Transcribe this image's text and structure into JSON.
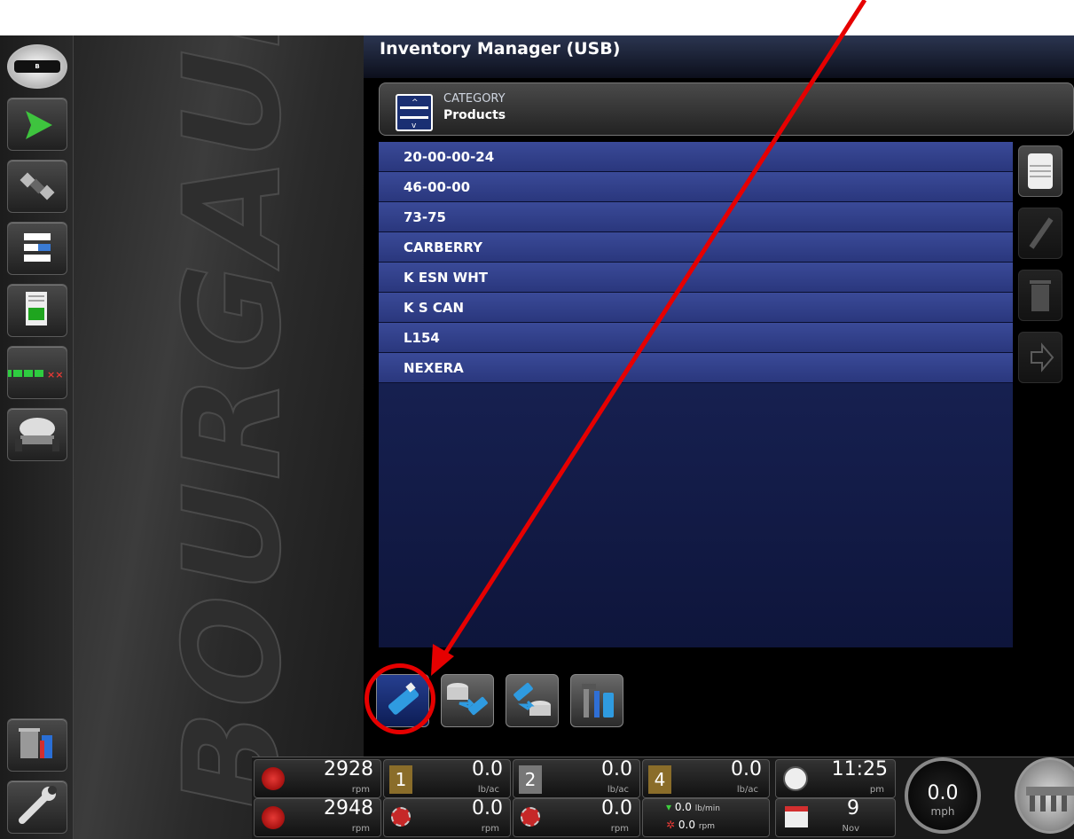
{
  "app": {
    "title": "Inventory Manager (USB)"
  },
  "sidebar": {
    "logo_icon": "bourgault-logo",
    "items": [
      {
        "name": "guidance-icon"
      },
      {
        "name": "gps-satellite-icon"
      },
      {
        "name": "product-layout-icon"
      },
      {
        "name": "report-icon"
      },
      {
        "name": "section-status-icon"
      },
      {
        "name": "implement-icon"
      }
    ],
    "bottom_items": [
      {
        "name": "trash-usb-icon"
      },
      {
        "name": "wrench-icon"
      }
    ]
  },
  "brand_watermark": "BOURGAULT",
  "category": {
    "label": "CATEGORY",
    "value": "Products"
  },
  "list": {
    "items": [
      "20-00-00-24",
      "46-00-00",
      "73-75",
      "CARBERRY",
      "K ESN WHT",
      "K S CAN",
      "L154",
      "NEXERA"
    ]
  },
  "right_toolbar": [
    "list-scroll-icon",
    "edit-pencil-icon",
    "delete-trash-icon",
    "export-arrow-icon"
  ],
  "bottom_toolbar": [
    "usb-drive-icon",
    "database-to-usb-icon",
    "usb-to-database-icon",
    "usb-tools-icon"
  ],
  "status_bar": {
    "rpm1": {
      "value": "2928",
      "unit": "rpm"
    },
    "rpm2": {
      "value": "2948",
      "unit": "rpm"
    },
    "tank1": {
      "num": "1",
      "rate": "0.0",
      "rate_unit": "lb/ac",
      "meter": "0.0",
      "meter_unit": "rpm"
    },
    "tank2": {
      "num": "2",
      "rate": "0.0",
      "rate_unit": "lb/ac",
      "meter": "0.0",
      "meter_unit": "rpm"
    },
    "tank4": {
      "num": "4",
      "rate": "0.0",
      "rate_unit": "lb/ac",
      "flow": "0.0",
      "flow_unit": "lb/min",
      "meter": "0.0",
      "meter_unit": "rpm"
    },
    "time": {
      "value": "11:25",
      "ampm": "pm"
    },
    "date": {
      "day": "9",
      "month": "Nov"
    },
    "speed": {
      "value": "0.0",
      "unit": "mph"
    }
  },
  "colors": {
    "list_bg": "#1e2a63",
    "list_item": "#3a4a98",
    "annotation": "#e60000"
  }
}
